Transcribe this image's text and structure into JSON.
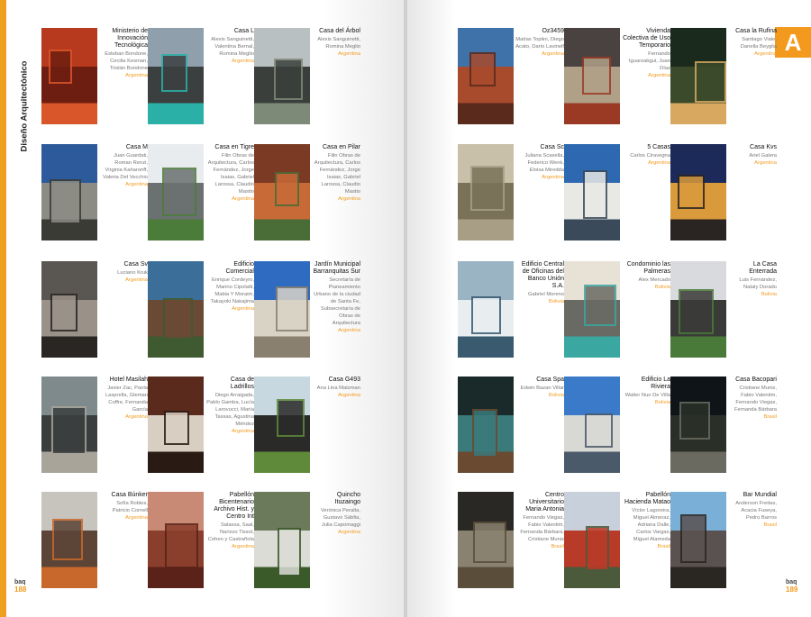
{
  "section_title": "Diseño Arquitectónico",
  "section_letter": "A",
  "folio_left": {
    "brand": "baq",
    "page": "188"
  },
  "folio_right": {
    "brand": "baq",
    "page": "189"
  },
  "cards": [
    {
      "title": "Ministerio de Innovación Tecnológica",
      "authors": "Esteban Bondone, Cecilia Kesman, Tristán Bondone",
      "country": "Argentina",
      "colors": [
        "#b83a1e",
        "#6e1e10",
        "#d9562a"
      ]
    },
    {
      "title": "Casa L",
      "authors": "Alexis Sanguinetti, Valentina Bernal, Romina Meglio",
      "country": "Argentina",
      "colors": [
        "#8fa0ac",
        "#3b3f40",
        "#2bb0a8"
      ]
    },
    {
      "title": "Casa del Árbol",
      "authors": "Alexis Sanguinetti, Romina Meglio",
      "country": "Argentina",
      "colors": [
        "#b9c0c2",
        "#3a3f3b",
        "#7d8a78"
      ]
    },
    {
      "title": "Casa M",
      "authors": "Juan Guardati, Roman Renzi, Virginia Kaharonff, Valeria Del Vecchio",
      "country": "Argentina",
      "colors": [
        "#2d5a9a",
        "#8c8c84",
        "#3b3b36"
      ]
    },
    {
      "title": "Casa en Tigre",
      "authors": "Filin Obras de Arquitectura, Carlos Fernández, Jorge Isaias, Gabriel Larossa, Claudio Mastio",
      "country": "Argentina",
      "colors": [
        "#e9ecee",
        "#6a7170",
        "#4b7c3a"
      ]
    },
    {
      "title": "Casa en Pilar",
      "authors": "Filin Obras de Arquitectura, Carlos Fernández, Jorge Isaias, Gabriel Larossa, Claudio Mastio",
      "country": "Argentina",
      "colors": [
        "#7a3a24",
        "#c86a38",
        "#4a6c36"
      ]
    },
    {
      "title": "Casa Sv",
      "authors": "Luciano Kruk",
      "country": "Argentina",
      "colors": [
        "#5a5652",
        "#9a9188",
        "#2a2624"
      ]
    },
    {
      "title": "Edificio Comercial",
      "authors": "Enrique Cordeyro, Marino Cipolatti, Mabia Y Moraim, Takayoki Nakajima",
      "country": "Argentina",
      "colors": [
        "#3c6e9a",
        "#6a4a34",
        "#3f5a30"
      ]
    },
    {
      "title": "Jardín Municipal Barranquitas Sur",
      "authors": "Secretaría de Planeamiento Urbano de la ciudad de Santa Fe, Subsecretaría de Obras de Arquitectura",
      "country": "Argentina",
      "colors": [
        "#2f6bc0",
        "#d9d3c6",
        "#8a8070"
      ]
    },
    {
      "title": "Hotel Masilah",
      "authors": "Javier Zac, Paola Lasprella, Gleman Coffre, Fernanda García",
      "country": "Argentina",
      "colors": [
        "#7f8a8c",
        "#3a3e3e",
        "#a8a49a"
      ]
    },
    {
      "title": "Casa de Ladrillos",
      "authors": "Diego Arraigada, Pablo Gamba, Lucía Larovucci, María Tassas, Agustina Méndez",
      "country": "Argentina",
      "colors": [
        "#5a2a1c",
        "#d8cfc2",
        "#2a1a14"
      ]
    },
    {
      "title": "Casa G493",
      "authors": "Ana Lina Matzman",
      "country": "Argentina",
      "colors": [
        "#c8d8e0",
        "#2a2a28",
        "#5e8a3a"
      ]
    },
    {
      "title": "Casa Búnker",
      "authors": "Sofía Robles, Patricio Cornell",
      "country": "Argentina",
      "colors": [
        "#c7c4be",
        "#5c4436",
        "#c9682c"
      ]
    },
    {
      "title": "Pabellón Bicentenario Archivo Hist. y Centro Int",
      "authors": "Salassa, Saal, Narizzo Tissot, Cohen y Castrañola",
      "country": "Argentina",
      "colors": [
        "#c88a74",
        "#8a3e2c",
        "#5a2218"
      ]
    },
    {
      "title": "Quincho Ituzaingo",
      "authors": "Verónica Peralta, Gustavo Säbfia, Julia Capomaggi",
      "country": "Argentina",
      "colors": [
        "#6a7a5a",
        "#dcdcd6",
        "#3a5a2a"
      ]
    },
    {
      "title": "Oz3459",
      "authors": "Matías Topiini, Diego Acato, Darío Lavinelf",
      "country": "Argentina",
      "colors": [
        "#3e72a8",
        "#a84a2c",
        "#5a2a1c"
      ]
    },
    {
      "title": "Vivienda Colectiva de Uso Temporario",
      "authors": "Fernando Iguarzabgui, Juan Díaz",
      "country": "Argentina",
      "colors": [
        "#4a4240",
        "#b0a088",
        "#9a3a24"
      ]
    },
    {
      "title": "Casa la Rufina",
      "authors": "Santiago Viale, Danella Beyglia",
      "country": "Argentina",
      "colors": [
        "#1a2a1c",
        "#3a4a2a",
        "#d8a860"
      ]
    },
    {
      "title": "Casa Sc",
      "authors": "Juliana Scasella, Federico Wenk, Eloisa Miredda",
      "country": "Argentina",
      "colors": [
        "#c8c0a8",
        "#7a7258",
        "#a89e86"
      ]
    },
    {
      "title": "5 Casas",
      "authors": "Carlos Ciravegna",
      "country": "Argentina",
      "colors": [
        "#2e68b0",
        "#e8e8e4",
        "#3a4a5a"
      ]
    },
    {
      "title": "Casa Kvs",
      "authors": "Ariel Galera",
      "country": "Argentina",
      "colors": [
        "#1c2a5a",
        "#d89a3a",
        "#2a2422"
      ]
    },
    {
      "title": "Edificio Central de Oficinas del Banco Unión S.A.",
      "authors": "Gabriel Moreno",
      "country": "Bolivia",
      "colors": [
        "#9ab4c4",
        "#e8eef0",
        "#3a5a70"
      ]
    },
    {
      "title": "Condominio las Palmeras",
      "authors": "Alex Mercado",
      "country": "Bolivia",
      "colors": [
        "#e8e2d6",
        "#6a6a64",
        "#3aa8a0"
      ]
    },
    {
      "title": "La Casa Enterrada",
      "authors": "Luis Fernández, Nataly Dorado",
      "country": "Bolivia",
      "colors": [
        "#d8dade",
        "#3a3a38",
        "#4a7a3a"
      ]
    },
    {
      "title": "Casa Spa",
      "authors": "Edwin Bazan Villar",
      "country": "Bolivia",
      "colors": [
        "#1a2a2a",
        "#3a7a7a",
        "#6a4a30"
      ]
    },
    {
      "title": "Edificio La Riviera",
      "authors": "Walter Nuo De Villa",
      "country": "Bolivia",
      "colors": [
        "#3a7ac8",
        "#d8d8d4",
        "#4a5a6a"
      ]
    },
    {
      "title": "Casa Bacopari",
      "authors": "Cristiane Muniz, Fabio Valentim, Fernando Viegas, Fernanda Bárbara",
      "country": "Brasil",
      "colors": [
        "#0e1418",
        "#2a3028",
        "#6a6a60"
      ]
    },
    {
      "title": "Centro Universitario Maria Antonia",
      "authors": "Fernando Viegas, Fabio Valentim, Fernanda Bárbara, Cristiane Muniz",
      "country": "Brasil",
      "colors": [
        "#2a2824",
        "#8a8270",
        "#5a4e3a"
      ]
    },
    {
      "title": "Pabellón Hacienda Matao",
      "authors": "Víctor Lagoreira, Miguel Almeraz, Adriana Dalle, Carlos Vargas, Miguel Alameda",
      "country": "Brasil",
      "colors": [
        "#c8d0dc",
        "#b83a28",
        "#4a5a3a"
      ]
    },
    {
      "title": "Bar Mundial",
      "authors": "Anderson Freitas, Acacia Fuseya, Pedro Barros",
      "country": "Brasil",
      "colors": [
        "#7ab0d8",
        "#5a5250",
        "#2a2622"
      ]
    }
  ]
}
